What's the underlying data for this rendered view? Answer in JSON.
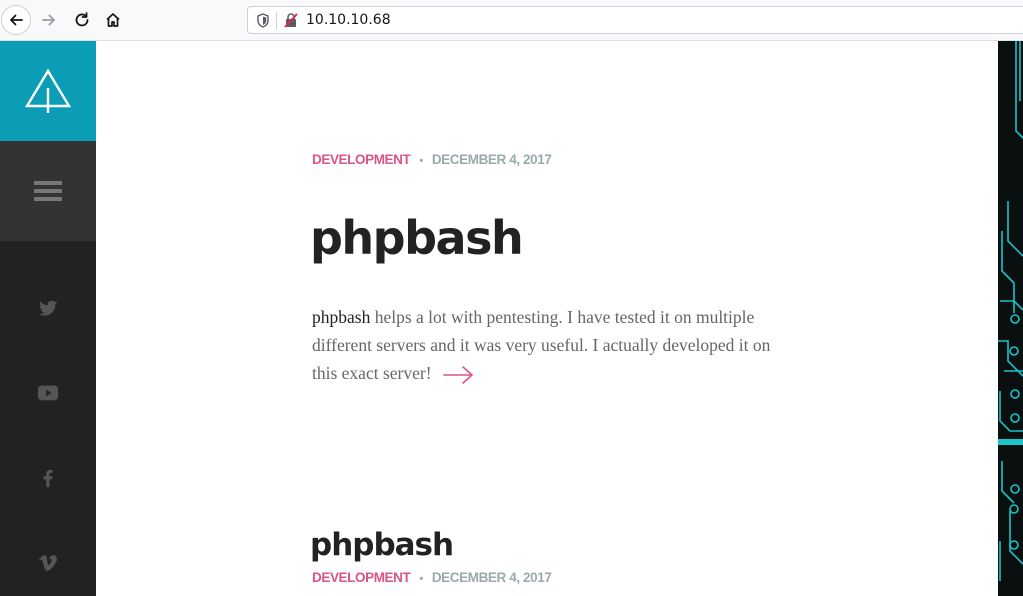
{
  "browser": {
    "url": "10.10.10.68",
    "icons": [
      "back-icon",
      "forward-icon",
      "reload-icon",
      "home-icon",
      "tracking-shield-icon",
      "insecure-lock-icon"
    ]
  },
  "sidebar": {
    "brand_color": "#0b9cb6",
    "logo_icon": "tree-logo-icon",
    "menu_icon": "hamburger-menu-icon",
    "social": [
      "twitter-icon",
      "youtube-icon",
      "facebook-icon",
      "vimeo-icon"
    ]
  },
  "posts": [
    {
      "category": "DEVELOPMENT",
      "separator": "•",
      "date": "DECEMBER 4, 2017",
      "title": "phpbash",
      "excerpt_lead": "phpbash",
      "excerpt_body": " helps a lot with pentesting. I have tested it on multiple different servers and it was very useful. I actually developed it on this exact server!",
      "read_more_icon": "arrow-right-icon"
    },
    {
      "category": "DEVELOPMENT",
      "separator": "•",
      "date": "DECEMBER 4, 2017",
      "title": "phpbash"
    }
  ],
  "colors": {
    "accent": "#d9548b",
    "meta": "#9aaaaa",
    "sidebar_bg": "#222222",
    "circuit": "#19c3c9"
  }
}
